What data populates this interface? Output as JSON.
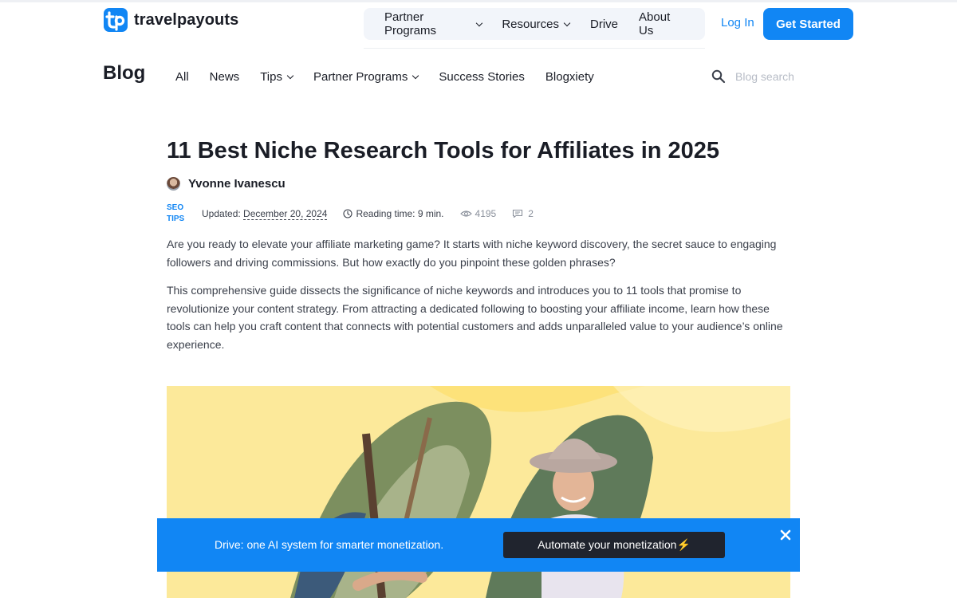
{
  "header": {
    "logo_text": "travelpayouts",
    "nav": [
      {
        "label": "Partner Programs",
        "dropdown": true
      },
      {
        "label": "Resources",
        "dropdown": true
      },
      {
        "label": "Drive",
        "dropdown": false
      },
      {
        "label": "About Us",
        "dropdown": false
      }
    ],
    "login_label": "Log In",
    "cta_label": "Get Started"
  },
  "blog": {
    "title": "Blog",
    "nav": [
      {
        "label": "All",
        "dropdown": false
      },
      {
        "label": "News",
        "dropdown": false
      },
      {
        "label": "Tips",
        "dropdown": true
      },
      {
        "label": "Partner Programs",
        "dropdown": true
      },
      {
        "label": "Success Stories",
        "dropdown": false
      },
      {
        "label": "Blogxiety",
        "dropdown": false
      }
    ],
    "search_placeholder": "Blog search"
  },
  "article": {
    "title": "11 Best Niche Research Tools for Affiliates in 2025",
    "author": "Yvonne Ivanescu",
    "tag_line1": "SEO",
    "tag_line2": "TIPS",
    "updated_label": "Updated:",
    "updated_date": "December 20, 2024",
    "reading_time": "Reading time: 9 min.",
    "views": "4195",
    "comments": "2",
    "paragraph1": "Are you ready to elevate your affiliate marketing game? It starts with niche keyword discovery, the secret sauce to engaging followers and driving commissions. But how exactly do you pinpoint these golden phrases?",
    "paragraph2": "This comprehensive guide dissects the significance of niche keywords and introduces you to 11 tools that promise to revolutionize your content strategy. From attracting a dedicated following to boosting your affiliate income, learn how these tools can help you craft content that connects with potential customers and adds unparalleled value to your audience’s online experience."
  },
  "banner": {
    "text": "Drive: one AI system for smarter monetization.",
    "button_label": "Automate your monetization⚡"
  },
  "colors": {
    "accent": "#1186f4",
    "hero_bg": "#fce99a",
    "button_dark": "#20242e"
  }
}
